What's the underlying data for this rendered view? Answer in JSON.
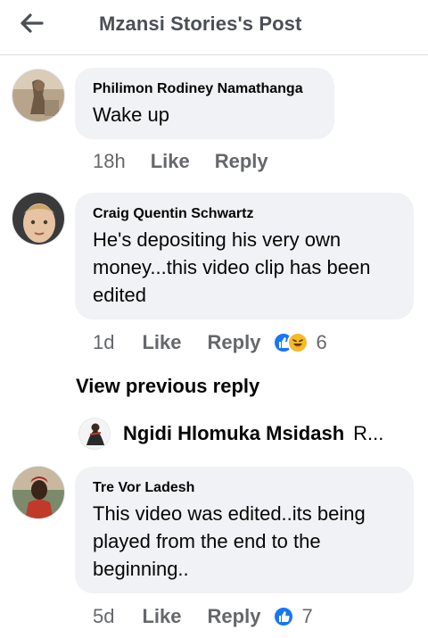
{
  "header": {
    "title": "Mzansi Stories's Post",
    "back_icon": "arrow-left-icon"
  },
  "comments": [
    {
      "author": "Philimon Rodiney Namathanga",
      "text": "Wake up",
      "time": "18h",
      "like_label": "Like",
      "reply_label": "Reply"
    },
    {
      "author": "Craig Quentin Schwartz",
      "text": "He's depositing his very own money...this video clip has been edited",
      "time": "1d",
      "like_label": "Like",
      "reply_label": "Reply",
      "reactions": [
        "like",
        "haha"
      ],
      "reaction_count": "6"
    },
    {
      "author": "Tre Vor Ladesh",
      "text": "This video was edited..its  being played from the end to the beginning..",
      "time": "5d",
      "like_label": "Like",
      "reply_label": "Reply",
      "reactions": [
        "like"
      ],
      "reaction_count": "7"
    }
  ],
  "replies": {
    "view_previous": "View previous reply",
    "preview_author": "Ngidi Hlomuka Msidash",
    "preview_snippet": "R..."
  },
  "colors": {
    "bubble": "#f0f2f5",
    "meta_text": "#65676b",
    "header_text": "#4b4f56",
    "like_blue": "#1877f2",
    "haha_yellow": "#f7b928"
  }
}
